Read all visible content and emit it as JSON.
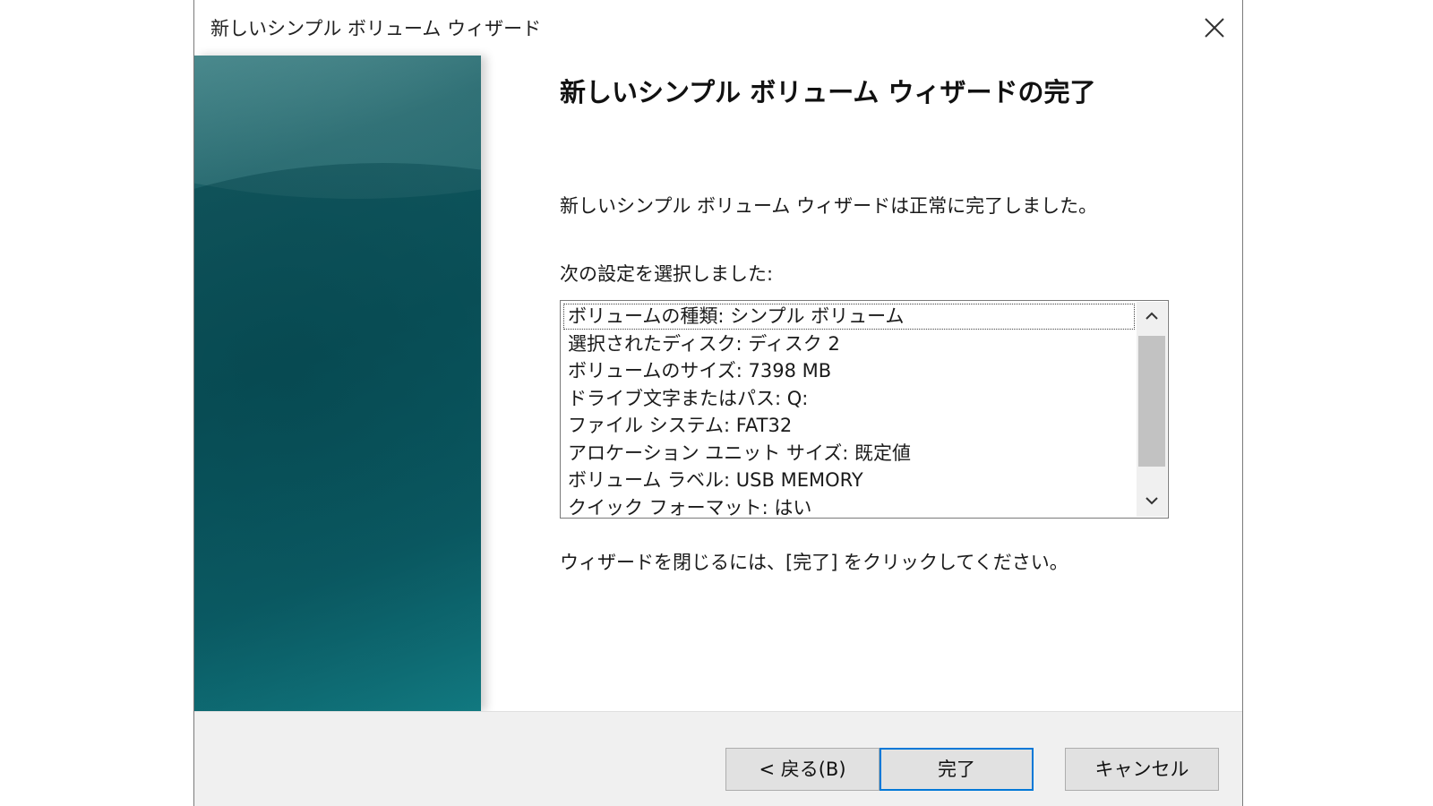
{
  "window": {
    "title": "新しいシンプル ボリューム ウィザード"
  },
  "content": {
    "heading": "新しいシンプル ボリューム ウィザードの完了",
    "success_text": "新しいシンプル ボリューム ウィザードは正常に完了しました。",
    "settings_label": "次の設定を選択しました:",
    "settings_list": [
      "ボリュームの種類: シンプル ボリューム",
      "選択されたディスク: ディスク 2",
      "ボリュームのサイズ: 7398 MB",
      "ドライブ文字またはパス: Q:",
      "ファイル システム: FAT32",
      "アロケーション ユニット サイズ: 既定値",
      "ボリューム ラベル: USB MEMORY",
      "クイック フォーマット: はい"
    ],
    "close_hint": "ウィザードを閉じるには、[完了] をクリックしてください。"
  },
  "buttons": {
    "back_label": "< 戻る(B)",
    "finish_label": "完了",
    "cancel_label": "キャンセル"
  },
  "icons": {
    "close": "close-icon",
    "scroll_up": "chevron-up-icon",
    "scroll_down": "chevron-down-icon"
  },
  "colors": {
    "accent": "#0078d7",
    "panel": "#0f5a62"
  }
}
